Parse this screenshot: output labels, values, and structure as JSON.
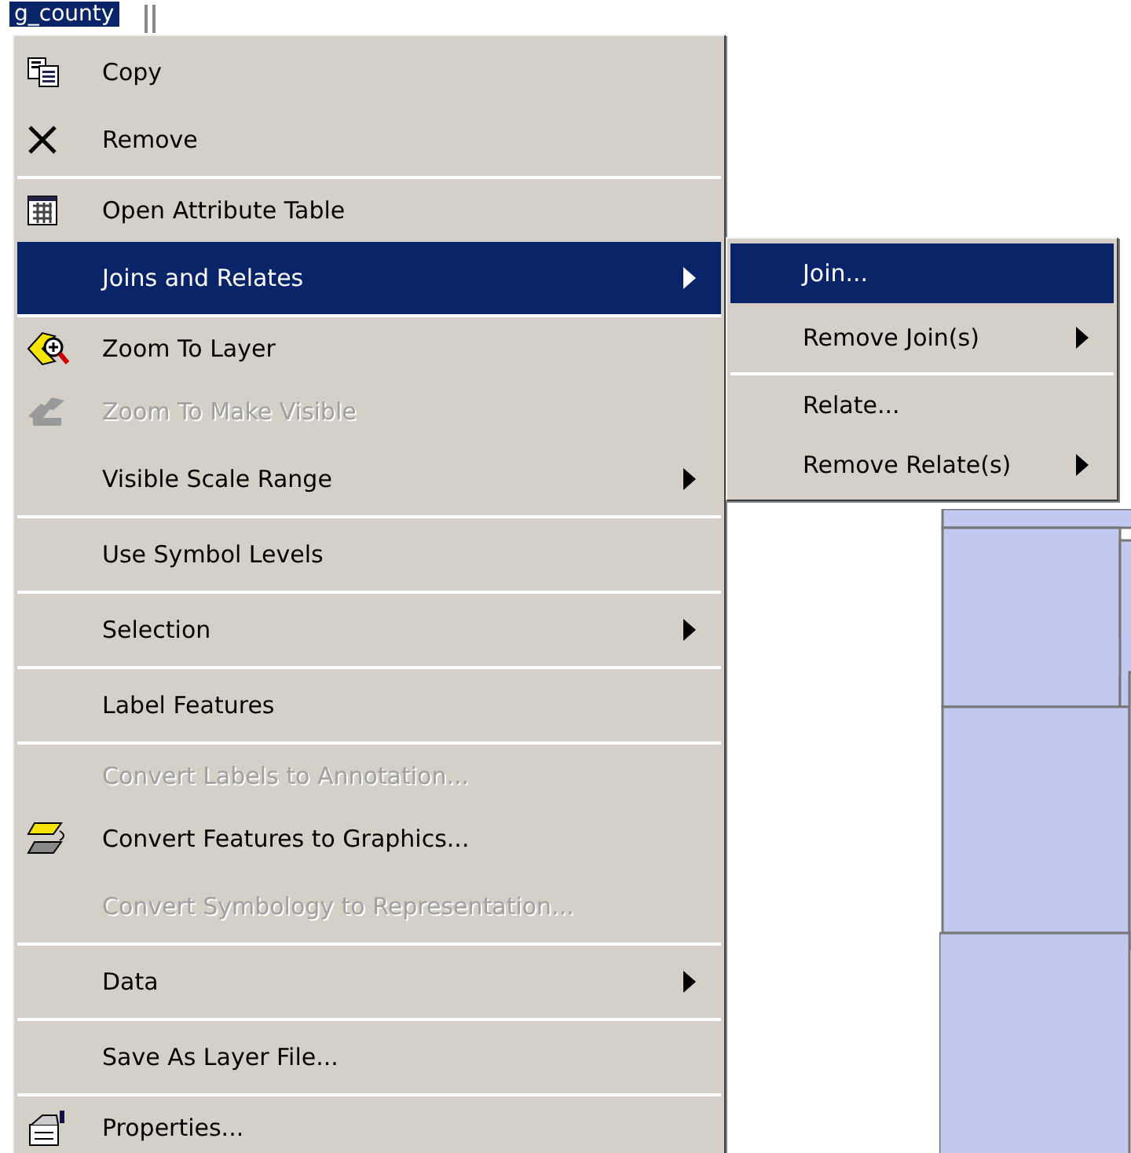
{
  "layer_label": {
    "text": "g_county",
    "selected": true
  },
  "menu": {
    "items": [
      {
        "kind": "copy",
        "label": "Copy",
        "disabled": false,
        "selected": false,
        "submenu": false,
        "separator_after": false
      },
      {
        "kind": "remove",
        "label": "Remove",
        "disabled": false,
        "selected": false,
        "submenu": false,
        "separator_after": true
      },
      {
        "kind": "table",
        "label": "Open Attribute Table",
        "disabled": false,
        "selected": false,
        "submenu": false,
        "separator_after": false
      },
      {
        "kind": "plain",
        "label": "Joins and Relates",
        "disabled": false,
        "selected": true,
        "submenu": true,
        "separator_after": true
      },
      {
        "kind": "zoom",
        "label": "Zoom To Layer",
        "disabled": false,
        "selected": false,
        "submenu": false,
        "separator_after": false
      },
      {
        "kind": "zoom-visible",
        "label": "Zoom To Make Visible",
        "disabled": true,
        "selected": false,
        "submenu": false,
        "separator_after": false
      },
      {
        "kind": "plain",
        "label": "Visible Scale Range",
        "disabled": false,
        "selected": false,
        "submenu": true,
        "separator_after": true
      },
      {
        "kind": "plain",
        "label": "Use Symbol Levels",
        "disabled": false,
        "selected": false,
        "submenu": false,
        "separator_after": true
      },
      {
        "kind": "plain",
        "label": "Selection",
        "disabled": false,
        "selected": false,
        "submenu": true,
        "separator_after": true
      },
      {
        "kind": "plain",
        "label": "Label Features",
        "disabled": false,
        "selected": false,
        "submenu": false,
        "separator_after": true
      },
      {
        "kind": "plain",
        "label": "Convert Labels to Annotation...",
        "disabled": true,
        "selected": false,
        "submenu": false,
        "separator_after": false
      },
      {
        "kind": "convert",
        "label": "Convert Features to Graphics...",
        "disabled": false,
        "selected": false,
        "submenu": false,
        "separator_after": false
      },
      {
        "kind": "plain",
        "label": "Convert Symbology to Representation...",
        "disabled": true,
        "selected": false,
        "submenu": false,
        "separator_after": true
      },
      {
        "kind": "plain",
        "label": "Data",
        "disabled": false,
        "selected": false,
        "submenu": true,
        "separator_after": true
      },
      {
        "kind": "plain",
        "label": "Save As Layer File...",
        "disabled": false,
        "selected": false,
        "submenu": false,
        "separator_after": true
      },
      {
        "kind": "properties",
        "label": "Properties...",
        "disabled": false,
        "selected": false,
        "submenu": false,
        "separator_after": false
      }
    ]
  },
  "submenu": {
    "items": [
      {
        "label": "Join...",
        "selected": true,
        "submenu": false,
        "separator_after": false
      },
      {
        "label": "Remove Join(s)",
        "selected": false,
        "submenu": true,
        "separator_after": true
      },
      {
        "label": "Relate...",
        "selected": false,
        "submenu": false,
        "separator_after": false
      },
      {
        "label": "Remove Relate(s)",
        "selected": false,
        "submenu": true,
        "separator_after": false
      }
    ]
  }
}
